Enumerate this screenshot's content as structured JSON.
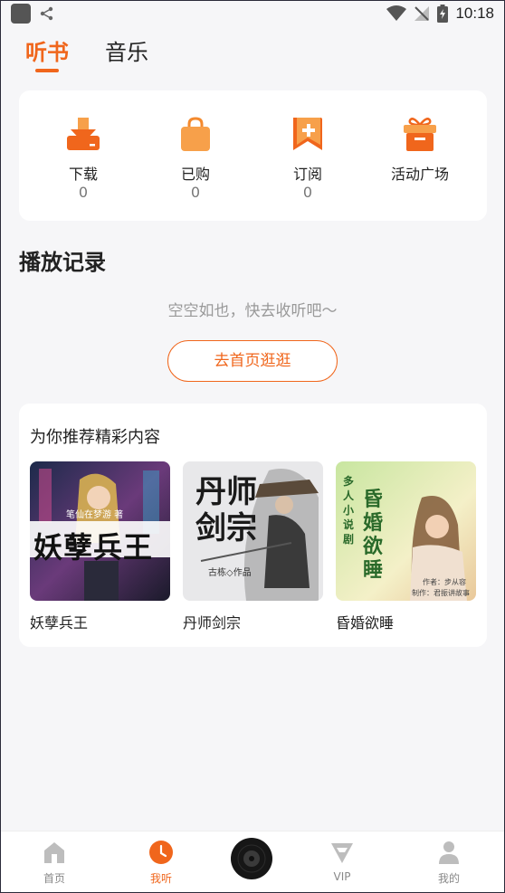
{
  "status_bar": {
    "time": "10:18"
  },
  "top_tabs": [
    {
      "label": "听书",
      "active": true
    },
    {
      "label": "音乐",
      "active": false
    }
  ],
  "quick_actions": [
    {
      "icon": "download-icon",
      "label": "下载",
      "count": "0"
    },
    {
      "icon": "shopping-bag-icon",
      "label": "已购",
      "count": "0"
    },
    {
      "icon": "bookmark-add-icon",
      "label": "订阅",
      "count": "0"
    },
    {
      "icon": "gift-icon",
      "label": "活动广场",
      "count": ""
    }
  ],
  "history": {
    "title": "播放记录",
    "empty_text": "空空如也，快去收听吧～",
    "go_home_button": "去首页逛逛"
  },
  "recommend": {
    "title": "为你推荐精彩内容",
    "books": [
      {
        "name": "妖孽兵王",
        "cover_title": "妖孽兵王",
        "cover_author": "笔仙在梦游 著"
      },
      {
        "name": "丹师剑宗",
        "cover_title": "丹师剑宗",
        "cover_author": "古栋◇作品"
      },
      {
        "name": "昏婚欲睡",
        "cover_title": "昏婚欲睡",
        "cover_tag": "多人小说剧",
        "cover_author": "作者：步从容",
        "cover_producer": "制作：君振讲故事"
      }
    ]
  },
  "bottom_nav": [
    {
      "icon": "home-icon",
      "label": "首页",
      "active": false
    },
    {
      "icon": "clock-icon",
      "label": "我听",
      "active": true
    },
    {
      "icon": "vip-icon",
      "label": "VIP",
      "active": false
    },
    {
      "icon": "user-icon",
      "label": "我的",
      "active": false
    }
  ],
  "colors": {
    "accent": "#f0661c",
    "background": "#f6f6f8"
  }
}
